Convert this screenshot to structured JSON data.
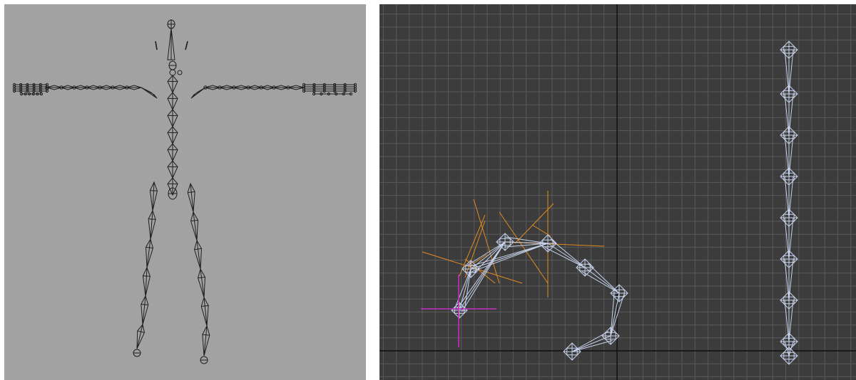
{
  "viewports": [
    {
      "view": "front",
      "background": "#a2a2a2",
      "wire_color": "#1e1e1e",
      "grid": false,
      "rig": "biped-skeleton"
    },
    {
      "view": "perspective",
      "background": "#3c3c3c",
      "grid": true,
      "grid_color": "#5a5a5a",
      "axis_color": "#0e0e0e",
      "bone_color": "#c8d4ee",
      "helper_color": "#e08a20",
      "selection_color": "#c02ec0",
      "objects": [
        "curled-bone-chain",
        "straight-bone-chain"
      ]
    }
  ]
}
